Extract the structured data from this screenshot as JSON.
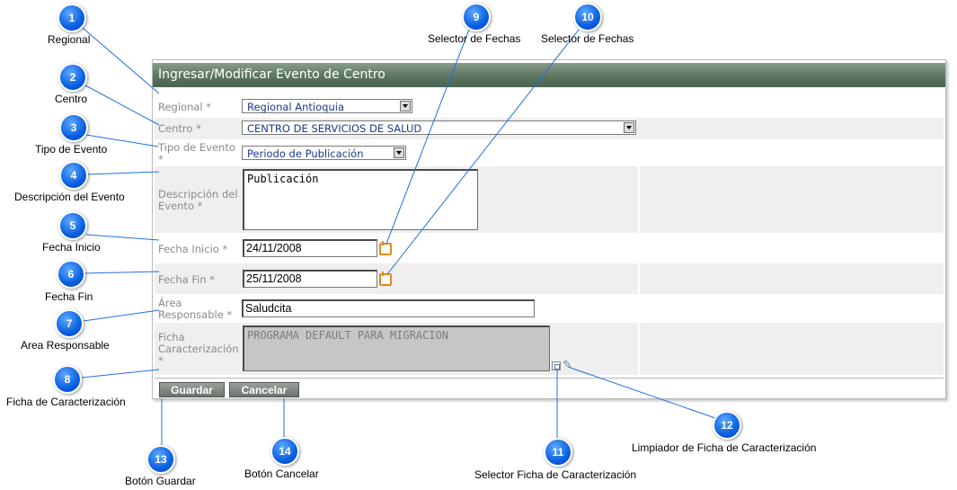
{
  "form": {
    "title": "Ingresar/Modificar Evento de Centro",
    "fields": {
      "regional": {
        "label": "Regional *",
        "value": "Regional Antioquia"
      },
      "centro": {
        "label": "Centro *",
        "value": "CENTRO DE SERVICIOS DE SALUD"
      },
      "tipo_evento": {
        "label_line1": "Tipo de Evento",
        "label_line2": "*",
        "value": "Periodo de Publicación"
      },
      "descripcion": {
        "label_line1": "Descripción del",
        "label_line2": "Evento *",
        "value": "Publicación"
      },
      "fecha_inicio": {
        "label": "Fecha Inicio *",
        "value": "24/11/2008"
      },
      "fecha_fin": {
        "label": "Fecha Fin *",
        "value": "25/11/2008"
      },
      "area": {
        "label_line1": "Área",
        "label_line2": "Responsable *",
        "value": "Saludcita"
      },
      "ficha": {
        "label_line1": "Ficha",
        "label_line2": "Caracterización",
        "label_line3": "*",
        "value": "PROGRAMA DEFAULT PARA MIGRACION"
      }
    },
    "buttons": {
      "save": "Guardar",
      "cancel": "Cancelar"
    },
    "icons": {
      "date_picker": "calendar-icon",
      "ficha_selector": "select-list-icon",
      "ficha_clear": "eraser-icon"
    }
  },
  "callouts": [
    {
      "number": "1",
      "label": "Regional"
    },
    {
      "number": "2",
      "label": "Centro"
    },
    {
      "number": "3",
      "label": "Tipo de Evento"
    },
    {
      "number": "4",
      "label": "Descripción del Evento"
    },
    {
      "number": "5",
      "label": "Fecha Inicio"
    },
    {
      "number": "6",
      "label": "Fecha Fin"
    },
    {
      "number": "7",
      "label": "Area Responsable"
    },
    {
      "number": "8",
      "label": "Ficha de Caracterización"
    },
    {
      "number": "9",
      "label": "Selector de Fechas"
    },
    {
      "number": "10",
      "label": "Selector de Fechas"
    },
    {
      "number": "11",
      "label": "Selector Ficha de Caracterización"
    },
    {
      "number": "12",
      "label": "Limpiador de Ficha de Caracterización"
    },
    {
      "number": "13",
      "label": "Botón Guardar"
    },
    {
      "number": "14",
      "label": "Botón Cancelar"
    }
  ],
  "colors": {
    "header": "#5c7560",
    "badge": "#0a5fe0",
    "calendar_icon": "#e08a1e",
    "row_shade": "#efefef"
  }
}
